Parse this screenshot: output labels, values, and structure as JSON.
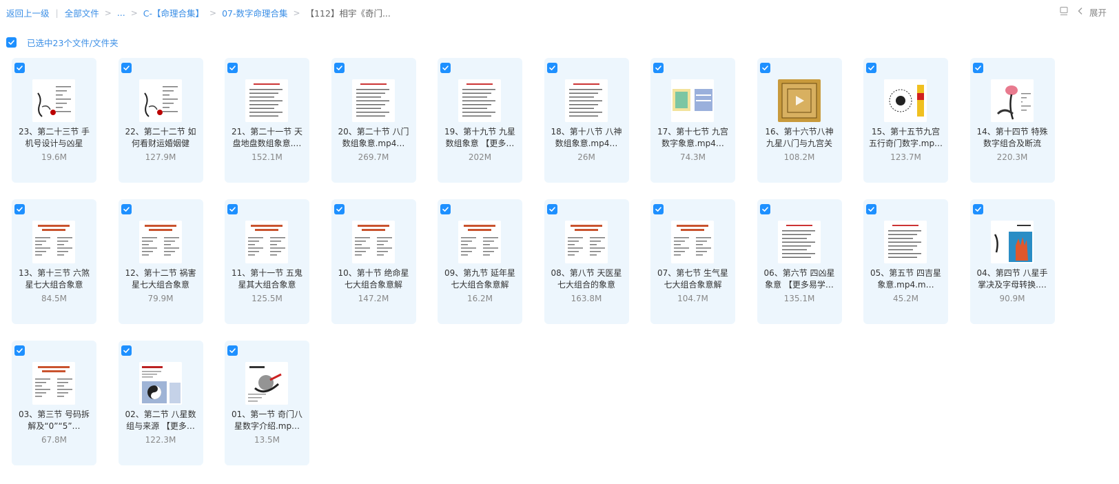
{
  "breadcrumb": {
    "back": "返回上一级",
    "all_files": "全部文件",
    "ellipsis": "...",
    "folder1": "C-【命理合集】",
    "folder2": "07-数字命理合集",
    "current": "【112】相宇《奇门..."
  },
  "toolbar": {
    "expand_label": "展开"
  },
  "selection": {
    "text": "已选中23个文件/文件夹",
    "checked": true
  },
  "accent_color": "#1e90ff",
  "files": [
    {
      "name": "23、第二十三节 手机号设计与凶星",
      "size": "19.6M",
      "thumb": "sketch"
    },
    {
      "name": "22、第二十二节 如何看财运婚姻健",
      "size": "127.9M",
      "thumb": "sketch"
    },
    {
      "name": "21、第二十一节 天盘地盘数组象意.…",
      "size": "152.1M",
      "thumb": "text"
    },
    {
      "name": "20、第二十节 八门数组象意.mp4…",
      "size": "269.7M",
      "thumb": "text"
    },
    {
      "name": "19、第十九节 九星数组象意 【更多…",
      "size": "202M",
      "thumb": "text"
    },
    {
      "name": "18、第十八节 八神数组象意.mp4…",
      "size": "26M",
      "thumb": "text"
    },
    {
      "name": "17、第十七节 九宫数字象意.mp4…",
      "size": "74.3M",
      "thumb": "grid"
    },
    {
      "name": "16、第十六节八神九星八门与九宫关",
      "size": "108.2M",
      "thumb": "gold"
    },
    {
      "name": "15、第十五节九宫五行奇门数字.mp…",
      "size": "123.7M",
      "thumb": "bagua"
    },
    {
      "name": "14、第十四节 特殊数字组合及断流",
      "size": "220.3M",
      "thumb": "lotus"
    },
    {
      "name": "13、第十三节 六煞星七大组合象意",
      "size": "84.5M",
      "thumb": "title"
    },
    {
      "name": "12、第十二节 祸害星七大组合象意",
      "size": "79.9M",
      "thumb": "title"
    },
    {
      "name": "11、第十一节 五鬼星其大组合象意",
      "size": "125.5M",
      "thumb": "title"
    },
    {
      "name": "10、第十节 绝命星七大组合象意解",
      "size": "147.2M",
      "thumb": "title"
    },
    {
      "name": "09、第九节 延年星七大组合象意解",
      "size": "16.2M",
      "thumb": "title"
    },
    {
      "name": "08、第八节 天医星七大组合的象意",
      "size": "163.8M",
      "thumb": "title"
    },
    {
      "name": "07、第七节 生气星七大组合象意解",
      "size": "104.7M",
      "thumb": "title"
    },
    {
      "name": "06、第六节 四凶星象意 【更多易学…",
      "size": "135.1M",
      "thumb": "text"
    },
    {
      "name": "05、第五节 四吉星象意.mp4.m…",
      "size": "45.2M",
      "thumb": "text"
    },
    {
      "name": "04、第四节 八星手掌决及字母转换.…",
      "size": "90.9M",
      "thumb": "hand"
    },
    {
      "name": "03、第三节 号码拆解及“0”“5”…",
      "size": "67.8M",
      "thumb": "title"
    },
    {
      "name": "02、第二节 八星数组与来源 【更多…",
      "size": "122.3M",
      "thumb": "yinyang"
    },
    {
      "name": "01、第一节 奇门八星数字介绍.mp…",
      "size": "13.5M",
      "thumb": "ink"
    }
  ]
}
